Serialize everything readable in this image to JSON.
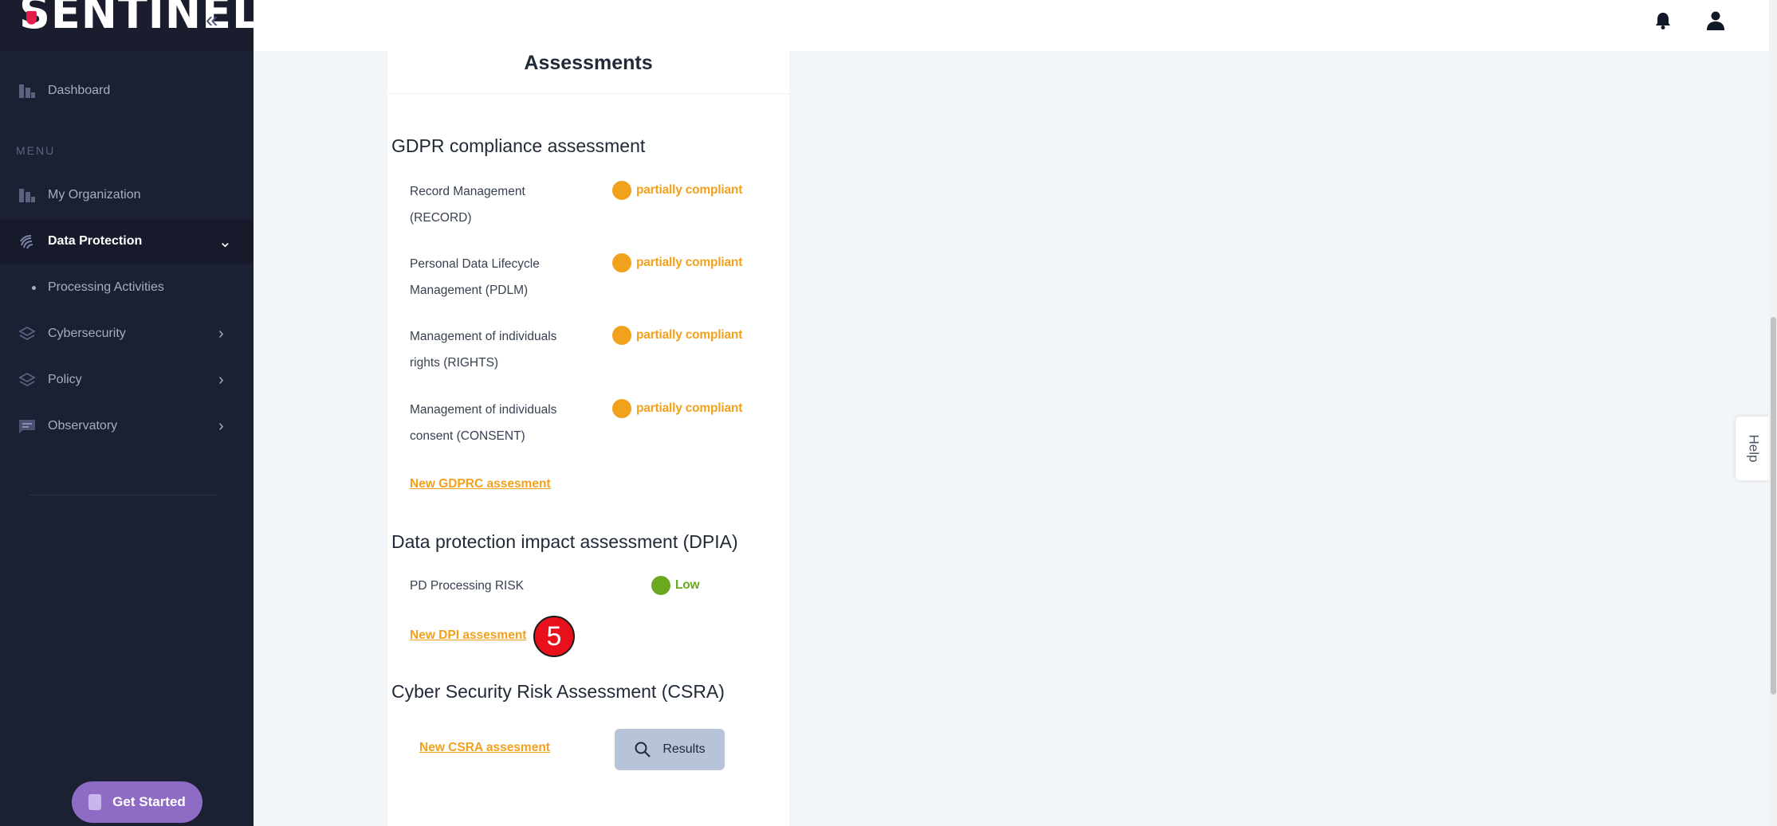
{
  "brand": {
    "logo_text": "SENTINEL",
    "collapse_icon": "double-chevron-left-icon"
  },
  "sidebar": {
    "dashboard_label": "Dashboard",
    "menu_title": "MENU",
    "items": [
      {
        "label": "My Organization",
        "icon": "building-icon"
      },
      {
        "label": "Data Protection",
        "icon": "fingerprint-icon"
      },
      {
        "label": "Cybersecurity",
        "icon": "layers-icon"
      },
      {
        "label": "Policy",
        "icon": "layers-icon"
      },
      {
        "label": "Observatory",
        "icon": "message-icon"
      }
    ],
    "sub_items": [
      {
        "label": "Processing Activities"
      }
    ],
    "get_started_label": "Get Started"
  },
  "card": {
    "title": "Assessments",
    "gdpr": {
      "title": "GDPR compliance assessment",
      "rows": [
        {
          "label_line1": "Record Management",
          "label_line2": "(RECORD)",
          "status": "partially compliant"
        },
        {
          "label_line1": "Personal Data Lifecycle",
          "label_line2": "Management (PDLM)",
          "status": "partially compliant"
        },
        {
          "label_line1": "Management of individuals",
          "label_line2": "rights (RIGHTS)",
          "status": "partially compliant"
        },
        {
          "label_line1": "Management of individuals",
          "label_line2": "consent (CONSENT)",
          "status": "partially compliant"
        }
      ],
      "new_link": "New GDPRC assesment"
    },
    "dpia": {
      "title": "Data protection impact assessment (DPIA)",
      "rows": [
        {
          "label": "PD Processing RISK",
          "status": "Low"
        }
      ],
      "new_link": "New DPI assesment"
    },
    "csra": {
      "title": "Cyber Security Risk Assessment (CSRA)",
      "new_link": "New CSRA assesment",
      "results_label": "Results"
    }
  },
  "step_badge": "5",
  "help_label": "Help",
  "colors": {
    "sidebar_bg": "#1c2033",
    "partial": "#f2a11c",
    "low": "#6aa820",
    "badge": "#e8111b",
    "get_started": "#8e6bc4"
  }
}
